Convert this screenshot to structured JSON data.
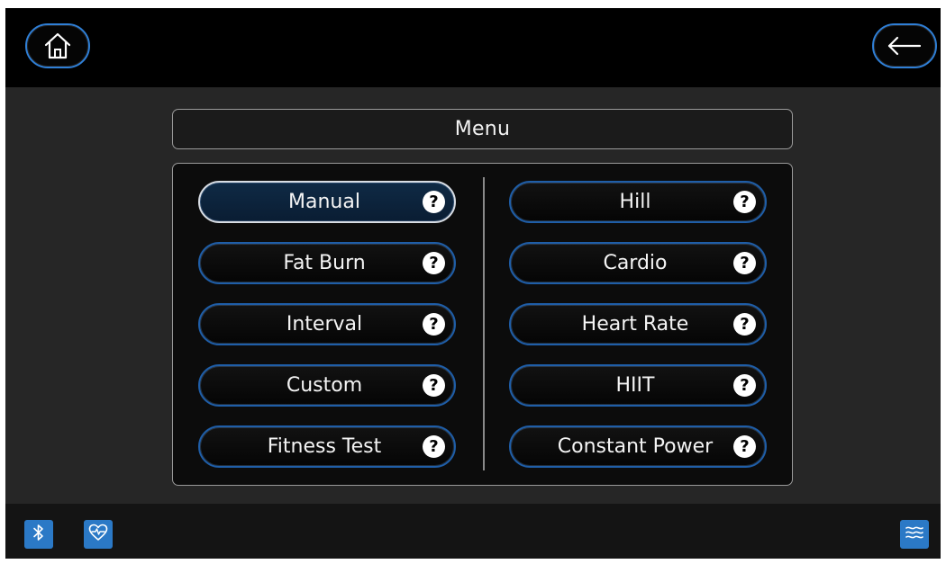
{
  "menu": {
    "title": "Menu"
  },
  "programs": {
    "left": [
      {
        "label": "Manual",
        "selected": true
      },
      {
        "label": "Fat Burn"
      },
      {
        "label": "Interval"
      },
      {
        "label": "Custom"
      },
      {
        "label": "Fitness Test"
      }
    ],
    "right": [
      {
        "label": "Hill"
      },
      {
        "label": "Cardio"
      },
      {
        "label": "Heart Rate"
      },
      {
        "label": "HIIT"
      },
      {
        "label": "Constant Power"
      }
    ]
  },
  "help_glyph": "?",
  "icons": {
    "home": "home-icon",
    "back": "back-arrow-icon",
    "bluetooth": "bluetooth-icon",
    "heart_rate": "heart-rate-icon",
    "fan": "fan-icon"
  },
  "colors": {
    "accent_blue": "#2b79c6",
    "button_border": "#1f5ea8",
    "selected_fill": "#0f2a45"
  }
}
